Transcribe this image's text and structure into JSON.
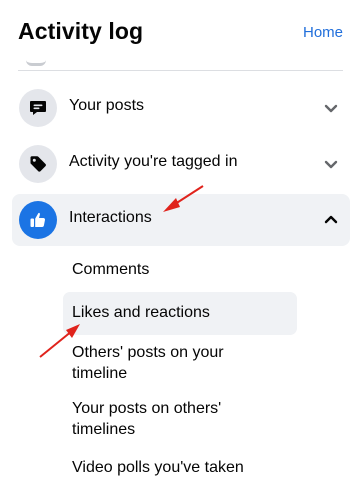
{
  "header": {
    "title": "Activity log",
    "home_link": "Home"
  },
  "menu": {
    "items": [
      {
        "label": "Your posts",
        "icon": "speech-bubble-icon",
        "expanded": false
      },
      {
        "label": "Activity you're tagged in",
        "icon": "tag-icon",
        "expanded": false
      },
      {
        "label": "Interactions",
        "icon": "thumbs-up-icon",
        "expanded": true
      }
    ],
    "interactions_subitems": [
      "Comments",
      "Likes and reactions",
      "Others' posts on your",
      "timeline",
      "Your posts on others'",
      "timelines",
      "Video polls you've taken"
    ]
  },
  "colors": {
    "accent": "#1b74e4",
    "link": "#216fdb",
    "annotation_arrow": "#e0231c",
    "highlight_bg": "#f0f2f5"
  }
}
